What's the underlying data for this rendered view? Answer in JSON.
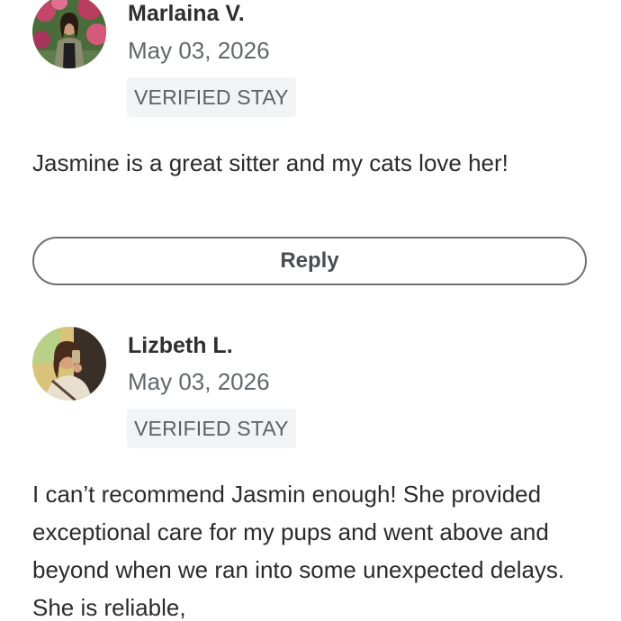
{
  "reviews": [
    {
      "name": "Marlaina V.",
      "date": "May 03, 2026",
      "badge": "VERIFIED STAY",
      "text": "Jasmine is a great sitter and my cats love her!",
      "avatar": "reviewer-photo"
    },
    {
      "name": "Lizbeth L.",
      "date": "May 03, 2026",
      "badge": "VERIFIED STAY",
      "text": "I can’t recommend Jasmin enough! She provided exceptional care for my pups and went above and beyond when we ran into some unexpected delays. She is reliable,",
      "avatar": "reviewer-photo"
    }
  ],
  "reply_label": "Reply"
}
